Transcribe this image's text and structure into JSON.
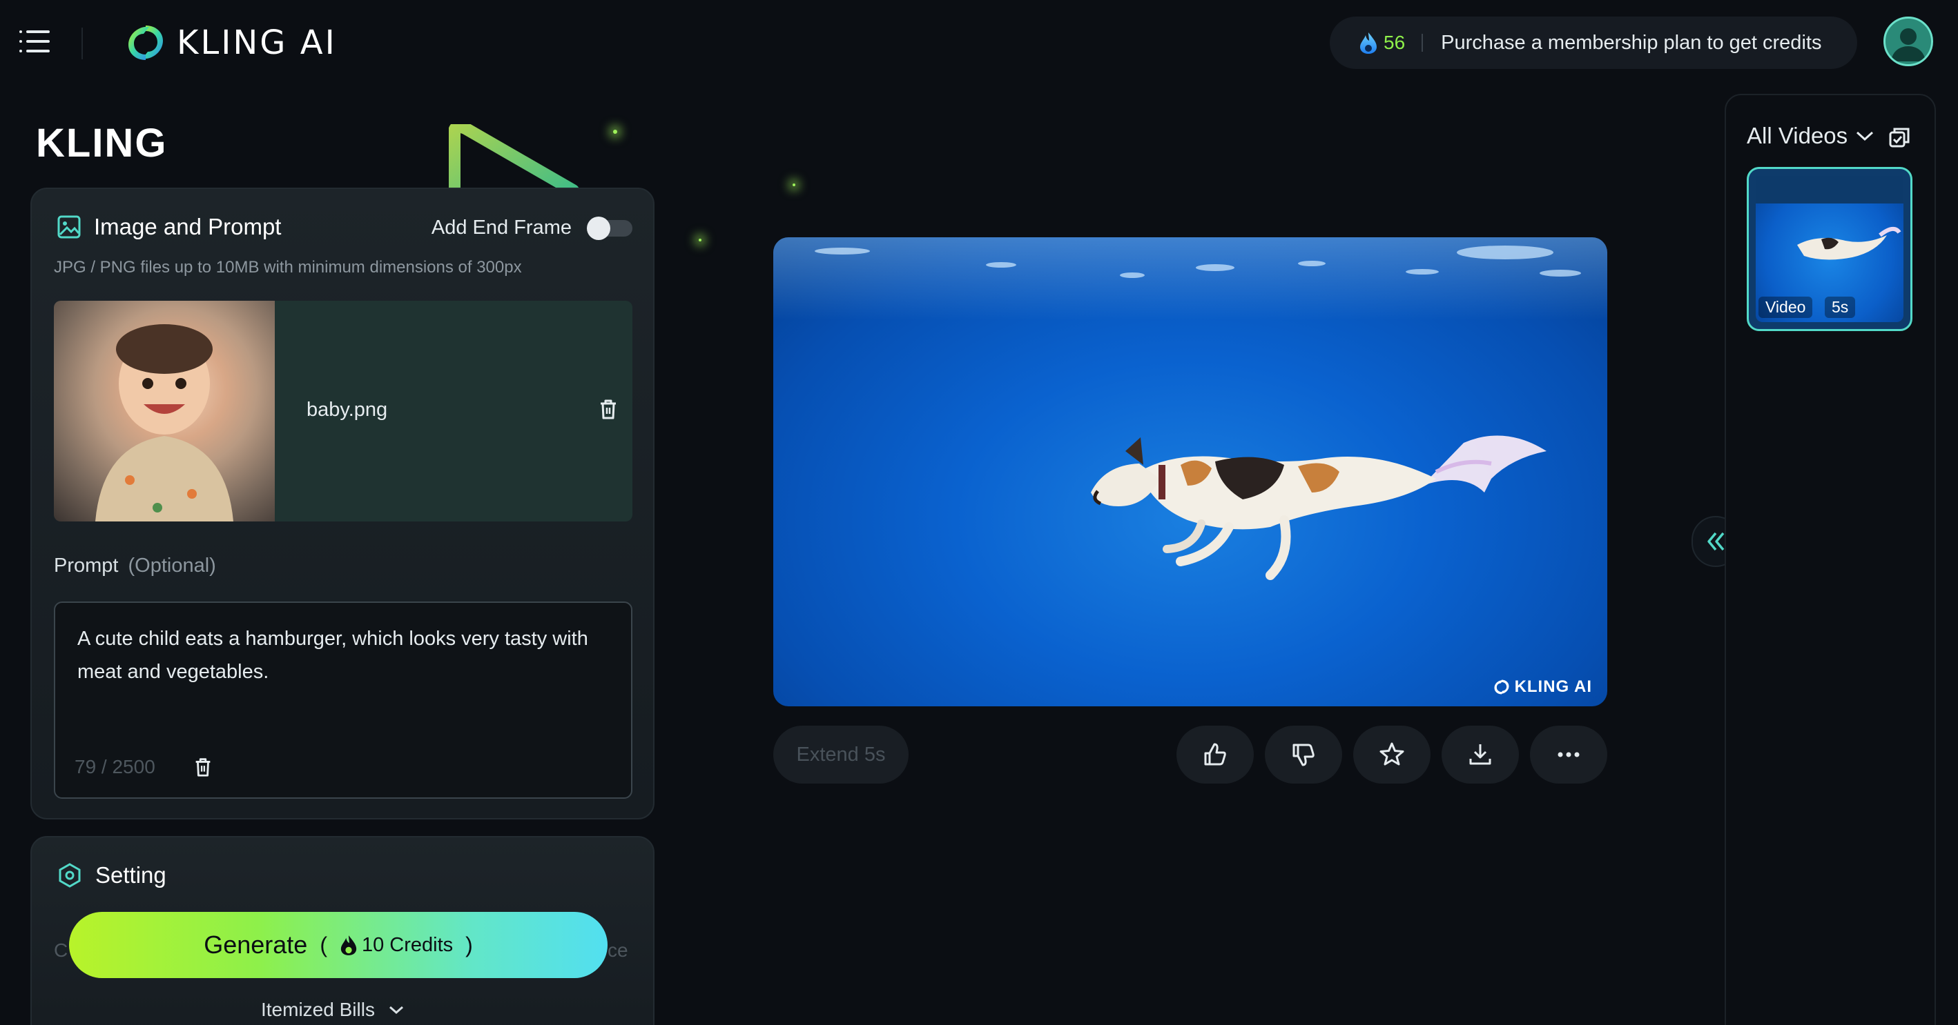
{
  "header": {
    "app_name": "KLING AI",
    "credits_count": "56",
    "membership_text": "Purchase a membership plan to get credits"
  },
  "hero": {
    "title": "KLING"
  },
  "image_card": {
    "title": "Image and Prompt",
    "end_frame_label": "Add End Frame",
    "end_frame_on": false,
    "hint": "JPG / PNG files up to 10MB with minimum dimensions of 300px",
    "file_name": "baby.png",
    "prompt_label": "Prompt",
    "prompt_optional": "(Optional)",
    "prompt_text": "A cute child eats a hamburger, which looks very tasty with meat and vegetables.",
    "char_count": "79  /  2500"
  },
  "setting_card": {
    "title": "Setting",
    "generate_label": "Generate",
    "generate_credits": "10 Credits",
    "itemized_label": "Itemized Bills"
  },
  "preview": {
    "watermark": "KLING AI",
    "extend_label": "Extend 5s",
    "actions": [
      "like-icon",
      "dislike-icon",
      "star-icon",
      "download-icon",
      "more-icon"
    ]
  },
  "right_panel": {
    "filter_label": "All Videos",
    "items": [
      {
        "type": "Video",
        "duration": "5s"
      }
    ]
  },
  "colors": {
    "accent_green": "#8ef04a",
    "accent_teal": "#52d9c8",
    "background": "#0b0e13"
  }
}
